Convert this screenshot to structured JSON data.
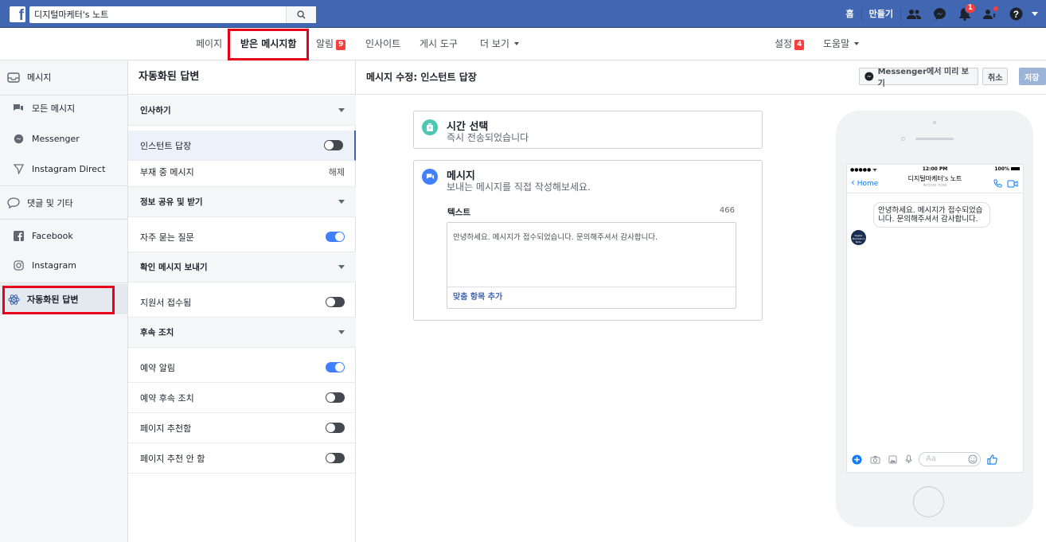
{
  "topbar": {
    "search_value": "디지털마케터's 노트",
    "home_label": "홈",
    "create_label": "만들기",
    "notification_count": "1"
  },
  "nav": {
    "items": [
      "페이지",
      "받은 메시지함",
      "알림",
      "인사이트",
      "게시 도구",
      "더 보기"
    ],
    "alerts_badge": "9",
    "settings_label": "설정",
    "settings_badge": "4",
    "help_label": "도움말"
  },
  "sidebar": {
    "messages_header": "메시지",
    "items": [
      "모든 메시지",
      "Messenger",
      "Instagram Direct"
    ],
    "comments_header": "댓글 및 기타",
    "comment_items": [
      "Facebook",
      "Instagram"
    ],
    "automated": "자동화된 답변"
  },
  "middle": {
    "title": "자동화된 답변",
    "rows": [
      {
        "label": "인사하기",
        "type": "section"
      },
      {
        "label": "인스턴트 답장",
        "type": "toggle",
        "on": false
      },
      {
        "label": "부재 중 메시지",
        "type": "text",
        "right": "해제"
      },
      {
        "label": "정보 공유 및 받기",
        "type": "section"
      },
      {
        "label": "자주 묻는 질문",
        "type": "toggle",
        "on": true
      },
      {
        "label": "확인 메시지 보내기",
        "type": "section"
      },
      {
        "label": "지원서 접수됨",
        "type": "toggle",
        "on": false
      },
      {
        "label": "후속 조치",
        "type": "section"
      },
      {
        "label": "예약 알림",
        "type": "toggle",
        "on": true
      },
      {
        "label": "예약 후속 조치",
        "type": "toggle",
        "on": false
      },
      {
        "label": "페이지 추천함",
        "type": "toggle",
        "on": false
      },
      {
        "label": "페이지 추천 안 함",
        "type": "toggle",
        "on": false
      }
    ]
  },
  "main": {
    "title": "메시지 수정: 인스턴트 답장",
    "preview_button": "Messenger에서 미리 보기",
    "cancel_button": "취소",
    "save_button": "저장",
    "time_card": {
      "title": "시간 선택",
      "subtitle": "즉시 전송되었습니다"
    },
    "message_card": {
      "title": "메시지",
      "subtitle": "보내는 메시지를 직접 작성해보세요.",
      "text_label": "텍스트",
      "char_count": "466",
      "text_value": "안녕하세요. 메시지가 접수되었습니다. 문의해주셔서 감사합니다.",
      "add_field": "맞춤 항목 추가"
    }
  },
  "phone": {
    "time": "12:00 PM",
    "battery": "100%",
    "signal": "●●●●● ᯤ",
    "back_label": "Home",
    "page_name": "디지털마케터's 노트",
    "active_status": "Active now",
    "message": "안녕하세요. 메시지가 접수되었습니다. 문의해주셔서 감사합니다.",
    "input_placeholder": "Aa",
    "avatar_text": "Digital Marketer's Note"
  }
}
